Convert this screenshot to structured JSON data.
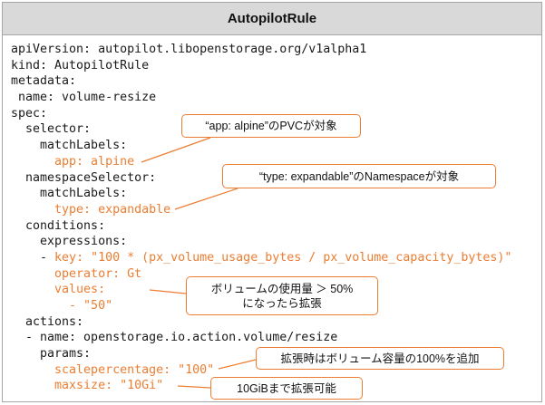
{
  "header": {
    "title": "AutopilotRule"
  },
  "colors": {
    "text": "#1a1a1a",
    "highlight": "#ED7D31",
    "callout_border": "#ED7D31",
    "header_bg": "#D9D9D9",
    "frame_border": "#A6A6A6"
  },
  "code": {
    "lines": [
      {
        "segments": [
          {
            "text": "apiVersion: autopilot.libopenstorage.org/v1alpha1",
            "highlight": false
          }
        ]
      },
      {
        "segments": [
          {
            "text": "kind: AutopilotRule",
            "highlight": false
          }
        ]
      },
      {
        "segments": [
          {
            "text": "metadata:",
            "highlight": false
          }
        ]
      },
      {
        "segments": [
          {
            "text": " name: volume-resize",
            "highlight": false
          }
        ]
      },
      {
        "segments": [
          {
            "text": "spec:",
            "highlight": false
          }
        ]
      },
      {
        "segments": [
          {
            "text": "  selector:",
            "highlight": false
          }
        ]
      },
      {
        "segments": [
          {
            "text": "    matchLabels:",
            "highlight": false
          }
        ]
      },
      {
        "segments": [
          {
            "text": "      app: alpine",
            "highlight": true
          }
        ]
      },
      {
        "segments": [
          {
            "text": "  namespaceSelector:",
            "highlight": false
          }
        ]
      },
      {
        "segments": [
          {
            "text": "    matchLabels:",
            "highlight": false
          }
        ]
      },
      {
        "segments": [
          {
            "text": "      type: expandable",
            "highlight": true
          }
        ]
      },
      {
        "segments": [
          {
            "text": "  conditions:",
            "highlight": false
          }
        ]
      },
      {
        "segments": [
          {
            "text": "    expressions:",
            "highlight": false
          }
        ]
      },
      {
        "segments": [
          {
            "text": "    - ",
            "highlight": false
          },
          {
            "text": "key: \"100 * (px_volume_usage_bytes / px_volume_capacity_bytes)\"",
            "highlight": true
          }
        ]
      },
      {
        "segments": [
          {
            "text": "      operator: Gt",
            "highlight": true
          }
        ]
      },
      {
        "segments": [
          {
            "text": "      values:",
            "highlight": true
          }
        ]
      },
      {
        "segments": [
          {
            "text": "        - \"50\"",
            "highlight": true
          }
        ]
      },
      {
        "segments": [
          {
            "text": "  actions:",
            "highlight": false
          }
        ]
      },
      {
        "segments": [
          {
            "text": "  - name: openstorage.io.action.volume/resize",
            "highlight": false
          }
        ]
      },
      {
        "segments": [
          {
            "text": "    params:",
            "highlight": false
          }
        ]
      },
      {
        "segments": [
          {
            "text": "      scalepercentage: \"100\"",
            "highlight": true
          }
        ]
      },
      {
        "segments": [
          {
            "text": "      maxsize: \"10Gi\"",
            "highlight": true
          }
        ]
      }
    ]
  },
  "callouts": {
    "app_selector": {
      "text": "“app: alpine”のPVCが対象"
    },
    "namespace_selector": {
      "text": "“type: expandable”のNamespaceが対象"
    },
    "threshold": {
      "lines": [
        "ボリュームの使用量 ＞ 50%",
        "になったら拡張"
      ]
    },
    "scale_percentage": {
      "text": "拡張時はボリューム容量の100%を追加"
    },
    "max_size": {
      "text": "10GiBまで拡張可能"
    }
  }
}
